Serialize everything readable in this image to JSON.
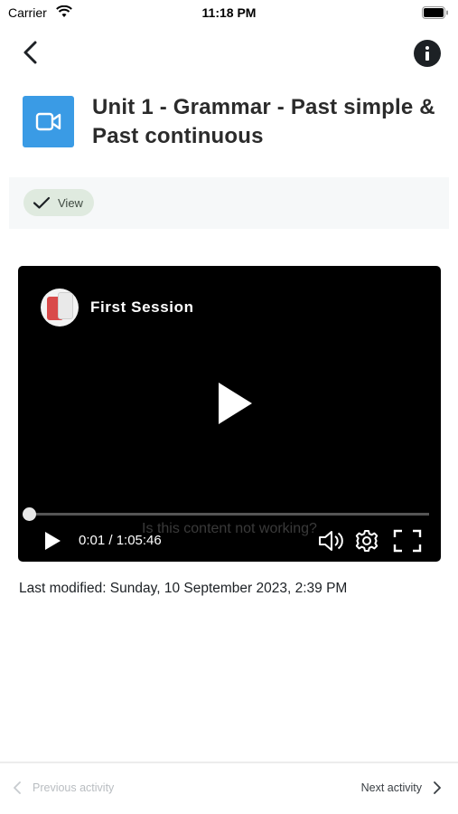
{
  "status_bar": {
    "carrier": "Carrier",
    "time": "11:18 PM"
  },
  "header": {
    "back_icon": "chevron-left-icon",
    "info_icon": "info-icon"
  },
  "module": {
    "icon": "video-camera-icon",
    "icon_color": "#3a9be5",
    "title": "Unit 1 - Grammar - Past simple & Past continuous"
  },
  "completion": {
    "label": "View",
    "icon": "check-icon"
  },
  "video": {
    "title": "First Session",
    "current_time": "0:01",
    "duration": "1:05:46",
    "time_display": "0:01 / 1:05:46",
    "progress_fraction": 0.002,
    "overlay_text": "Is this content not working?"
  },
  "last_modified": "Last modified: Sunday, 10 September 2023, 2:39 PM",
  "footer": {
    "previous_label": "Previous activity",
    "next_label": "Next activity"
  }
}
